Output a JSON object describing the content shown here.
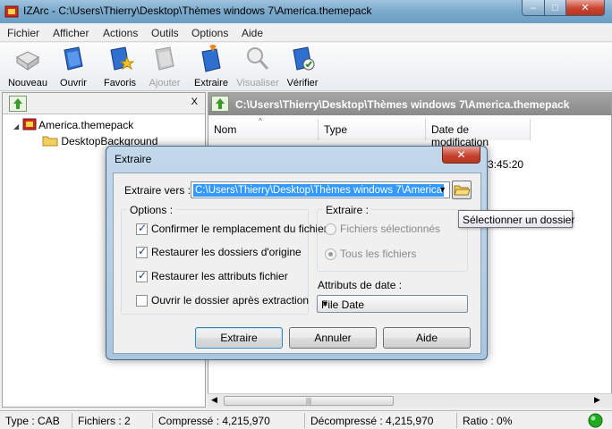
{
  "window": {
    "title": "IZArc - C:\\Users\\Thierry\\Desktop\\Thèmes windows 7\\America.themepack",
    "caption": {
      "min": "–",
      "max": "□",
      "close": "✕"
    }
  },
  "menu": [
    "Fichier",
    "Afficher",
    "Actions",
    "Outils",
    "Options",
    "Aide"
  ],
  "toolbar": {
    "nouveau": "Nouveau",
    "ouvrir": "Ouvrir",
    "favoris": "Favoris",
    "ajouter": "Ajouter",
    "extraire": "Extraire",
    "visualiser": "Visualiser",
    "verifier": "Vérifier"
  },
  "left_pane": {
    "close_x": "X",
    "tree": [
      "America.themepack",
      "DesktopBackground"
    ]
  },
  "right_pane": {
    "path": "C:\\Users\\Thierry\\Desktop\\Thèmes windows 7\\America.themepack",
    "columns": [
      "Nom",
      "Type",
      "Date de modification"
    ],
    "visible_row_fragment": "3:45:20"
  },
  "dialog": {
    "title": "Extraire",
    "close": "✕",
    "extract_to_label": "Extraire vers :",
    "extract_to_value": "C:\\Users\\Thierry\\Desktop\\Thèmes windows 7\\America",
    "options_label": "Options :",
    "options": [
      {
        "label": "Confirmer le remplacement du fichier",
        "checked": true
      },
      {
        "label": "Restaurer les dossiers d'origine",
        "checked": true
      },
      {
        "label": "Restaurer les attributs fichier",
        "checked": true
      },
      {
        "label": "Ouvrir le dossier après extraction",
        "checked": false
      }
    ],
    "extract_group_label": "Extraire :",
    "radio_selected_files": "Fichiers sélectionnés",
    "radio_all_files": "Tous les fichiers",
    "date_attr_label": "Attributs de date :",
    "date_attr_value": "File Date",
    "buttons": {
      "extract": "Extraire",
      "cancel": "Annuler",
      "help": "Aide"
    }
  },
  "tooltip": "Sélectionner un dossier",
  "status": {
    "type": "Type : CAB",
    "files": "Fichiers : 2",
    "compressed": "Compressé : 4,215,970",
    "decompressed": "Décompressé : 4,215,970",
    "ratio": "Ratio : 0%"
  },
  "colors": {
    "accent": "#3399ff",
    "status_ok": "#22aa22"
  }
}
